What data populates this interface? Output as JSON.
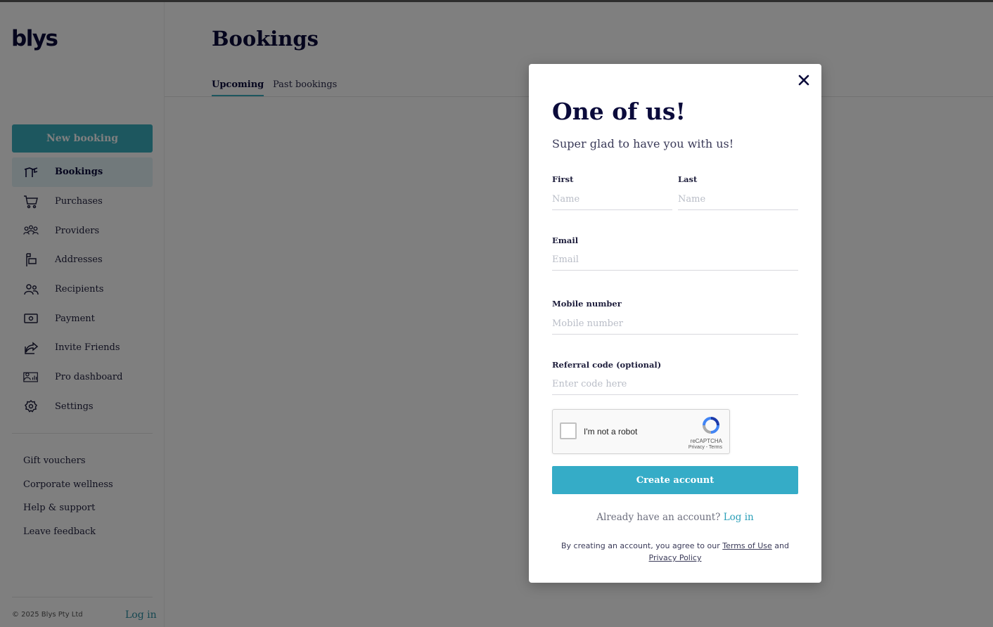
{
  "app": {
    "logo": "blys"
  },
  "sidebar": {
    "new_booking_label": "New booking",
    "items": [
      {
        "label": "Bookings",
        "icon": "bookings-icon"
      },
      {
        "label": "Purchases",
        "icon": "cart-icon"
      },
      {
        "label": "Providers",
        "icon": "providers-icon"
      },
      {
        "label": "Addresses",
        "icon": "mailbox-icon"
      },
      {
        "label": "Recipients",
        "icon": "recipients-icon"
      },
      {
        "label": "Payment",
        "icon": "payment-icon"
      },
      {
        "label": "Invite Friends",
        "icon": "share-icon"
      },
      {
        "label": "Pro dashboard",
        "icon": "pro-dashboard-icon"
      },
      {
        "label": "Settings",
        "icon": "gear-icon"
      }
    ],
    "links": [
      "Gift vouchers",
      "Corporate wellness",
      "Help & support",
      "Leave feedback"
    ],
    "copyright": "© 2025 Blys Pty Ltd",
    "login_label": "Log in"
  },
  "main": {
    "title": "Bookings",
    "tabs": [
      {
        "label": "Upcoming",
        "active": true
      },
      {
        "label": "Past bookings",
        "active": false
      }
    ]
  },
  "modal": {
    "title": "One of us!",
    "subtitle": "Super glad to have you with us!",
    "first_label": "First",
    "first_placeholder": "Name",
    "last_label": "Last",
    "last_placeholder": "Name",
    "email_label": "Email",
    "email_placeholder": "Email",
    "mobile_label": "Mobile number",
    "mobile_placeholder": "Mobile number",
    "referral_label": "Referral code (optional)",
    "referral_placeholder": "Enter code here",
    "captcha": {
      "label": "I'm not a robot",
      "brand": "reCAPTCHA",
      "terms": "Privacy - Terms"
    },
    "create_button": "Create account",
    "already_text": "Already have an account?",
    "login_link": "Log in",
    "legal_prefix": "By creating an account, you agree to our",
    "terms_link": "Terms of Use",
    "legal_and": "and",
    "privacy_link": "Privacy Policy"
  },
  "colors": {
    "accent": "#3aaebf",
    "navy": "#0b0b3b",
    "overlay": "rgba(0,0,0,0.5)"
  }
}
